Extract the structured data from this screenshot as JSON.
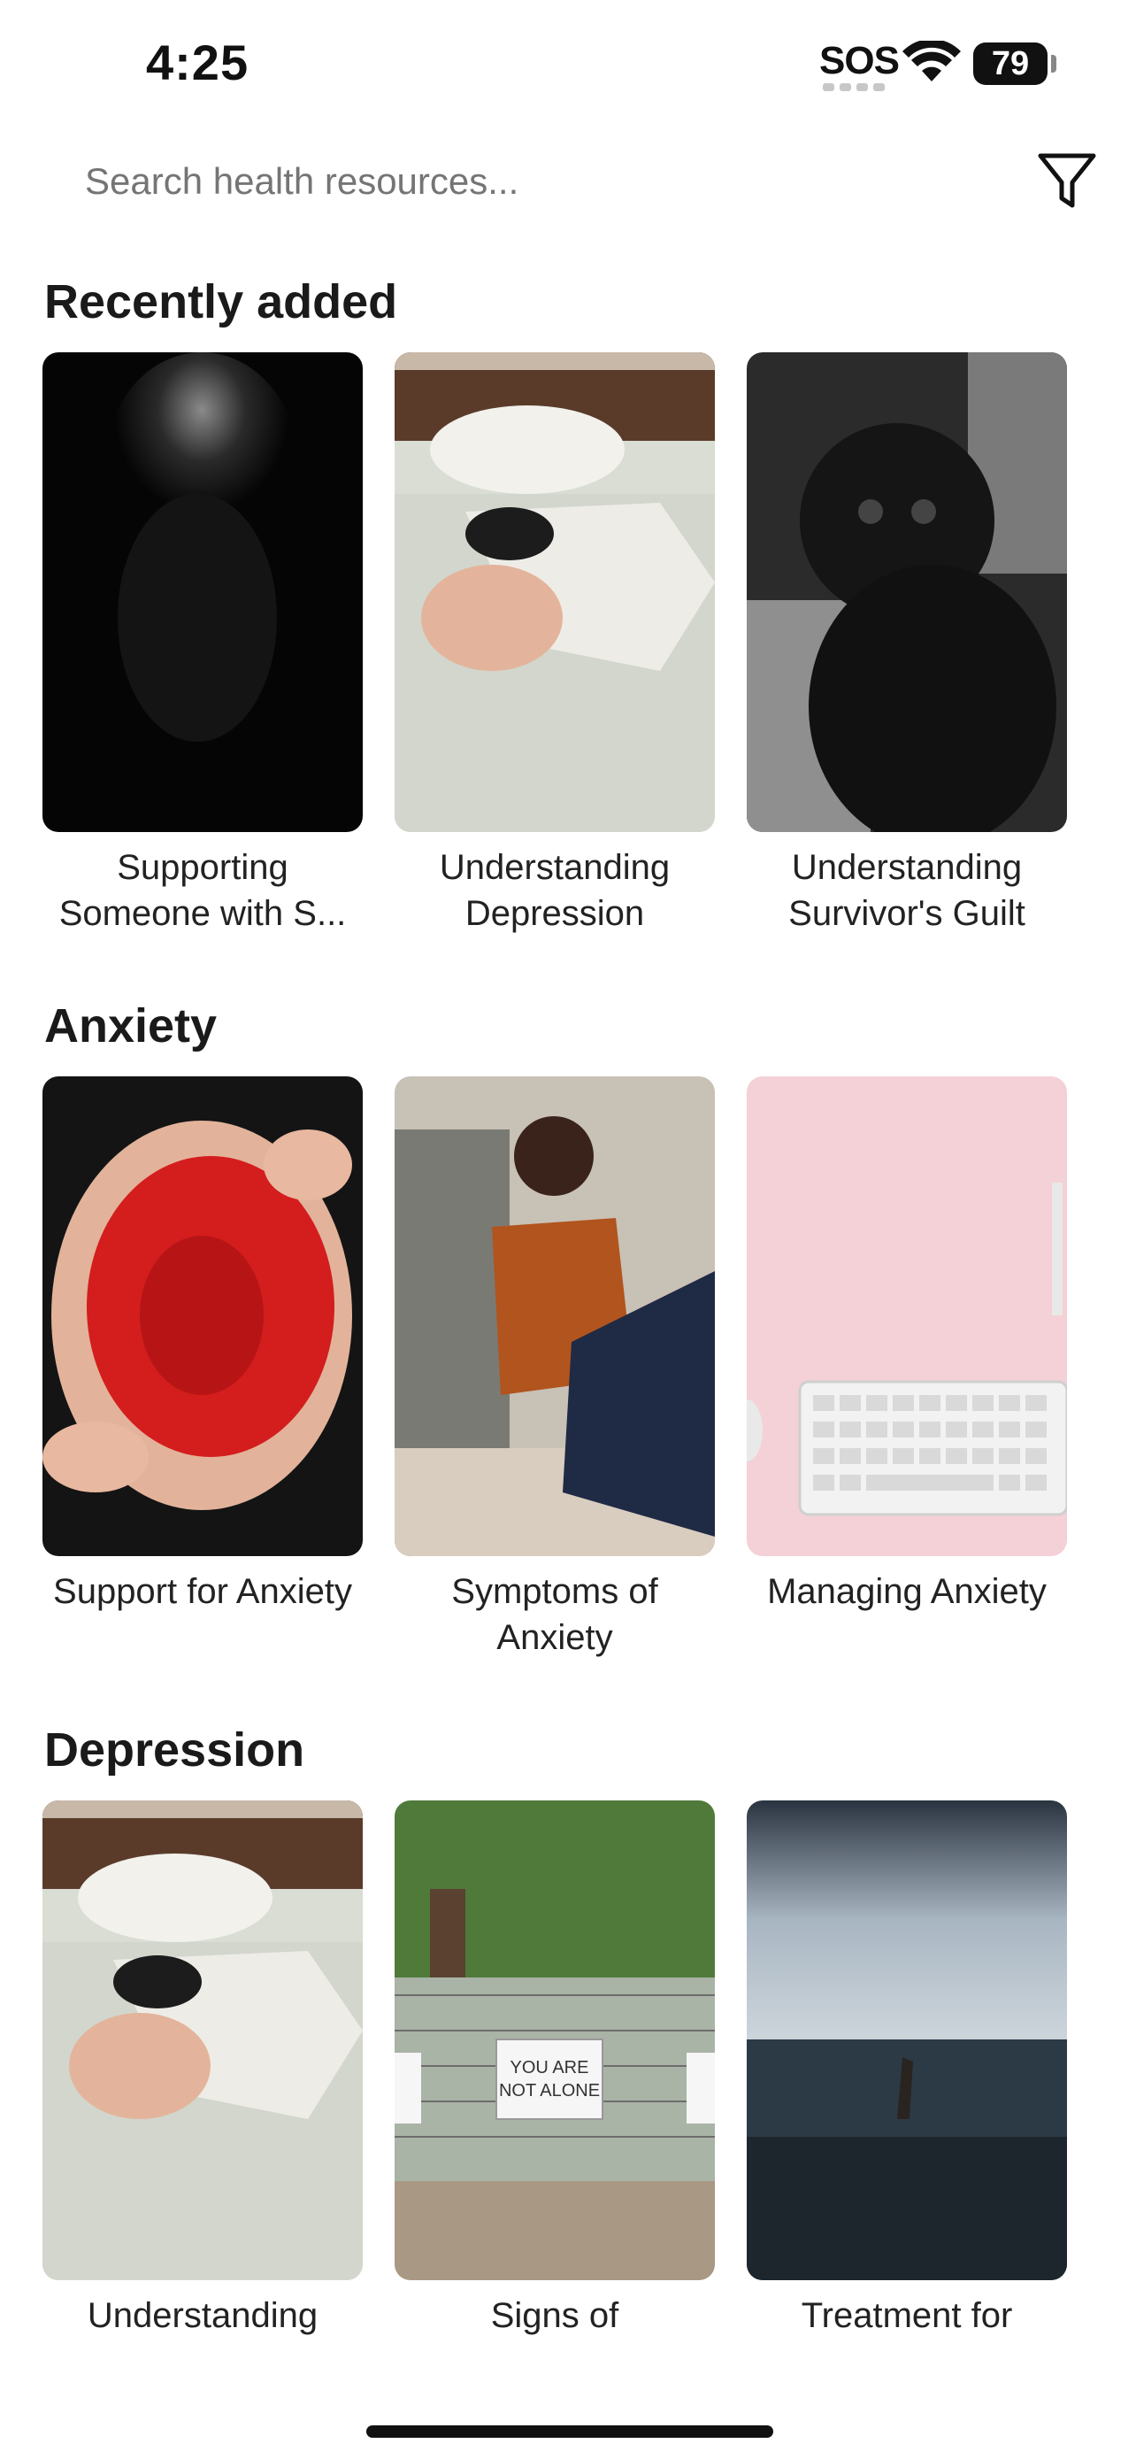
{
  "status_bar": {
    "time": "4:25",
    "sos": "SOS",
    "battery": "79"
  },
  "search": {
    "placeholder": "Search health resources..."
  },
  "sections": [
    {
      "title": "Recently added",
      "items": [
        {
          "caption": "Supporting Someone with S...",
          "image": "blurred-face-portrait"
        },
        {
          "caption": "Understanding Depression",
          "image": "person-lying-on-bed"
        },
        {
          "caption": "Understanding Survivor's Guilt",
          "image": "black-pug"
        }
      ]
    },
    {
      "title": "Anxiety",
      "items": [
        {
          "caption": "Support for Anxiety",
          "image": "painted-hands-circle"
        },
        {
          "caption": "Symptoms of Anxiety",
          "image": "person-sitting-against-sofa"
        },
        {
          "caption": "Managing Anxiety",
          "image": "pink-desk-keyboard"
        }
      ]
    },
    {
      "title": "Depression",
      "items": [
        {
          "caption": "Understanding",
          "image": "person-lying-on-bed"
        },
        {
          "caption": "Signs of",
          "image": "you-are-not-alone-sign"
        },
        {
          "caption": "Treatment for",
          "image": "hand-in-sea"
        }
      ]
    }
  ],
  "you_are_not_alone_sign": "YOU ARE NOT ALONE",
  "colors": {
    "background": "#ffffff",
    "text": "#111111"
  }
}
